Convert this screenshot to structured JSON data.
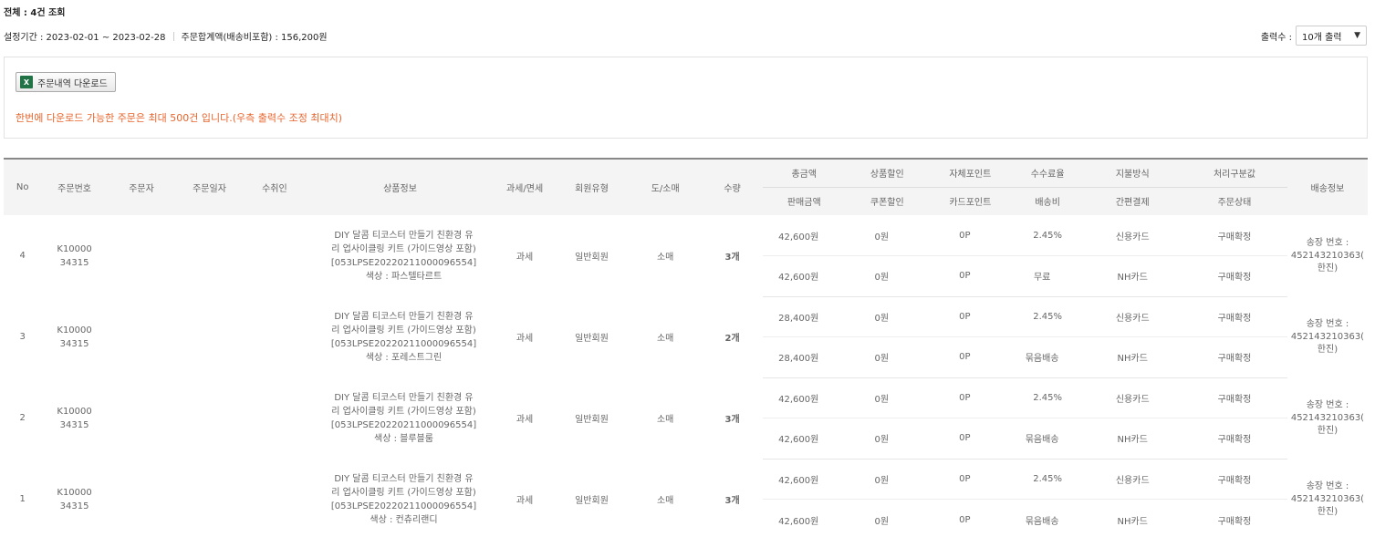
{
  "summary": {
    "total": "전체 : 4건 조회",
    "period": "설정기간 : 2023-02-01 ~ 2023-02-28",
    "order_total": "주문합계액(배송비포함) : 156,200원"
  },
  "output": {
    "label": "출력수 :",
    "value": "10개 출력"
  },
  "download": {
    "button": "주문내역 다운로드",
    "icon_text": "X",
    "notice": "한번에 다운로드 가능한 주문은 최대 500건 입니다.(우측 출력수 조정 최대치)"
  },
  "table": {
    "headers": {
      "no": "No",
      "order_no": "주문번호",
      "orderer": "주문자",
      "order_date": "주문일자",
      "recipient": "수취인",
      "product": "상품정보",
      "tax": "과세/면세",
      "member": "회원유형",
      "retail": "도/소매",
      "qty": "수량",
      "total_amount": "총금액",
      "sale_amount": "판매금액",
      "product_discount": "상품할인",
      "coupon_discount": "쿠폰할인",
      "own_point": "자체포인트",
      "card_point": "카드포인트",
      "fee_rate": "수수료율",
      "shipping_fee": "배송비",
      "pay_method": "지불방식",
      "easy_pay": "간편결제",
      "process_value": "처리구분값",
      "order_status": "주문상태",
      "delivery": "배송정보"
    },
    "rows": [
      {
        "no": "4",
        "order_no_1": "K10000",
        "order_no_2": "34315",
        "product_1": "DIY 달콤 티코스터 만들기 친환경 유",
        "product_2": "리 업사이클링 키트 (가이드영상 포함)",
        "product_3": "[053LPSE20220211000096554]",
        "product_4": "색상 : 파스텔타르트",
        "tax": "과세",
        "member": "일반회원",
        "retail": "소매",
        "qty": "3개",
        "total_amount": "42,600원",
        "product_discount": "0원",
        "own_point": "0P",
        "fee_rate": "2.45%",
        "pay_method": "신용카드",
        "process_value": "구매확정",
        "sale_amount": "42,600원",
        "coupon_discount": "0원",
        "card_point": "0P",
        "shipping_fee": "무료",
        "easy_pay": "NH카드",
        "order_status": "구매확정",
        "ship_1": "송장 번호 :",
        "ship_2": "452143210363(",
        "ship_3": "한진)"
      },
      {
        "no": "3",
        "order_no_1": "K10000",
        "order_no_2": "34315",
        "product_1": "DIY 달콤 티코스터 만들기 친환경 유",
        "product_2": "리 업사이클링 키트 (가이드영상 포함)",
        "product_3": "[053LPSE20220211000096554]",
        "product_4": "색상 : 포레스트그린",
        "tax": "과세",
        "member": "일반회원",
        "retail": "소매",
        "qty": "2개",
        "total_amount": "28,400원",
        "product_discount": "0원",
        "own_point": "0P",
        "fee_rate": "2.45%",
        "pay_method": "신용카드",
        "process_value": "구매확정",
        "sale_amount": "28,400원",
        "coupon_discount": "0원",
        "card_point": "0P",
        "shipping_fee": "묶음배송",
        "easy_pay": "NH카드",
        "order_status": "구매확정",
        "ship_1": "송장 번호 :",
        "ship_2": "452143210363(",
        "ship_3": "한진)"
      },
      {
        "no": "2",
        "order_no_1": "K10000",
        "order_no_2": "34315",
        "product_1": "DIY 달콤 티코스터 만들기 친환경 유",
        "product_2": "리 업사이클링 키트 (가이드영상 포함)",
        "product_3": "[053LPSE20220211000096554]",
        "product_4": "색상 : 블루블룸",
        "tax": "과세",
        "member": "일반회원",
        "retail": "소매",
        "qty": "3개",
        "total_amount": "42,600원",
        "product_discount": "0원",
        "own_point": "0P",
        "fee_rate": "2.45%",
        "pay_method": "신용카드",
        "process_value": "구매확정",
        "sale_amount": "42,600원",
        "coupon_discount": "0원",
        "card_point": "0P",
        "shipping_fee": "묶음배송",
        "easy_pay": "NH카드",
        "order_status": "구매확정",
        "ship_1": "송장 번호 :",
        "ship_2": "452143210363(",
        "ship_3": "한진)"
      },
      {
        "no": "1",
        "order_no_1": "K10000",
        "order_no_2": "34315",
        "product_1": "DIY 달콤 티코스터 만들기 친환경 유",
        "product_2": "리 업사이클링 키트 (가이드영상 포함)",
        "product_3": "[053LPSE20220211000096554]",
        "product_4": "색상 : 컨츄리랜디",
        "tax": "과세",
        "member": "일반회원",
        "retail": "소매",
        "qty": "3개",
        "total_amount": "42,600원",
        "product_discount": "0원",
        "own_point": "0P",
        "fee_rate": "2.45%",
        "pay_method": "신용카드",
        "process_value": "구매확정",
        "sale_amount": "42,600원",
        "coupon_discount": "0원",
        "card_point": "0P",
        "shipping_fee": "묶음배송",
        "easy_pay": "NH카드",
        "order_status": "구매확정",
        "ship_1": "송장 번호 :",
        "ship_2": "452143210363(",
        "ship_3": "한진)"
      }
    ]
  }
}
